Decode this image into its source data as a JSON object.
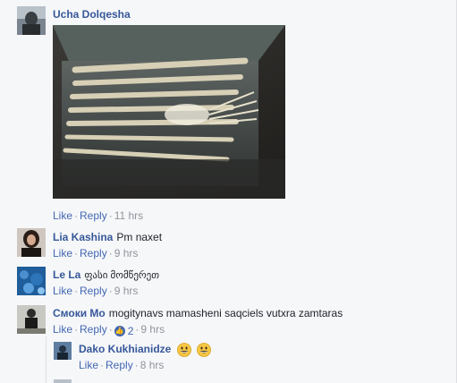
{
  "comments": [
    {
      "author": "Ucha Dolqesha",
      "text": "",
      "actions": {
        "like": "Like",
        "reply": "Reply",
        "time": "11 hrs"
      }
    },
    {
      "author": "Lia Kashina",
      "text": "Pm naxet",
      "actions": {
        "like": "Like",
        "reply": "Reply",
        "time": "9 hrs"
      }
    },
    {
      "author": "Le La",
      "text": "ფასი მომწერეთ",
      "actions": {
        "like": "Like",
        "reply": "Reply",
        "time": "9 hrs"
      }
    },
    {
      "author": "Смоки Мо",
      "text": "mogitynavs mamasheni saqciels vutxra zamtaras",
      "actions": {
        "like": "Like",
        "reply": "Reply",
        "like_count": "2",
        "time": "9 hrs"
      }
    }
  ],
  "reply": {
    "author": "Dako Kukhianidze",
    "actions": {
      "like": "Like",
      "reply": "Reply",
      "time": "8 hrs"
    }
  },
  "colors": {
    "link": "#365899",
    "action": "#4267b2",
    "meta": "#90949c",
    "background": "#f6f7f9"
  }
}
